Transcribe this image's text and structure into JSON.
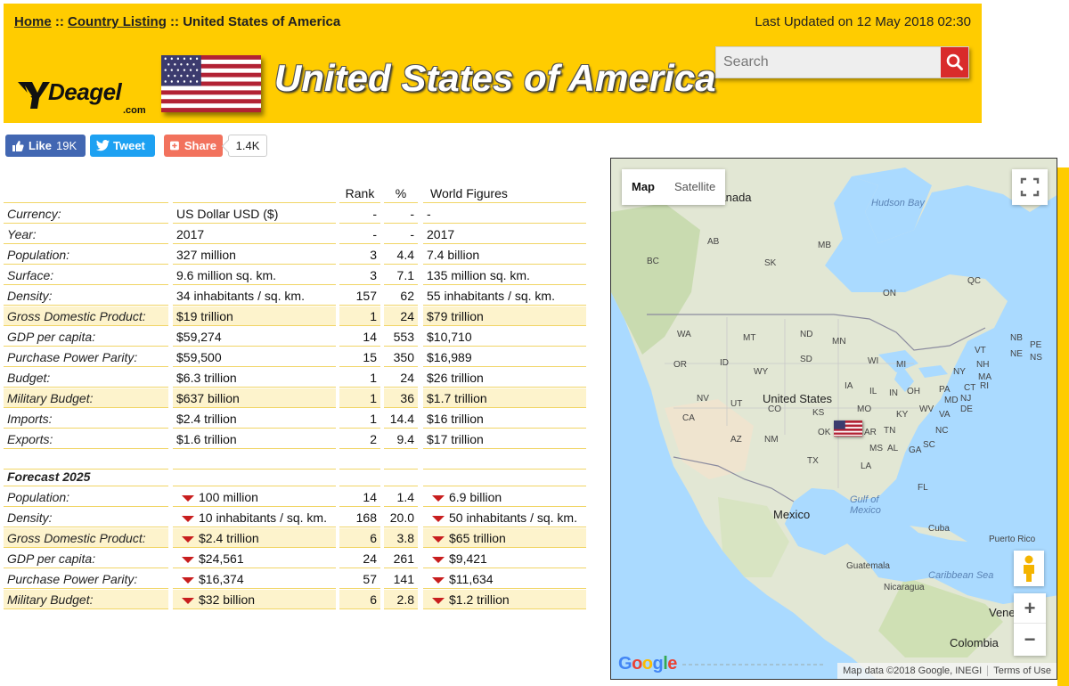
{
  "header": {
    "breadcrumb": {
      "home": "Home",
      "separator": "::",
      "country_listing": "Country Listing",
      "current": "United States of America"
    },
    "last_updated": "Last Updated on 12 May 2018 02:30",
    "logo_text": "Deagel",
    "logo_suffix": ".com",
    "country_title": "United States of America",
    "search_placeholder": "Search",
    "colors": {
      "header_bg": "#ffcc00",
      "search_button": "#d92b2b"
    }
  },
  "social": {
    "like_label": "Like",
    "like_count": "19K",
    "tweet_label": "Tweet",
    "share_label": "Share",
    "share_count": "1.4K"
  },
  "table": {
    "headers": {
      "rank": "Rank",
      "pct": "%",
      "world": "World Figures"
    },
    "rows": [
      {
        "label": "Currency:",
        "value": "US Dollar USD ($)",
        "rank": "-",
        "pct": "-",
        "world": "-",
        "highlight": false
      },
      {
        "label": "Year:",
        "value": "2017",
        "rank": "-",
        "pct": "-",
        "world": "2017",
        "highlight": false
      },
      {
        "label": "Population:",
        "value": "327 million",
        "rank": "3",
        "pct": "4.4",
        "world": "7.4 billion",
        "highlight": false
      },
      {
        "label": "Surface:",
        "value": "9.6 million sq. km.",
        "rank": "3",
        "pct": "7.1",
        "world": "135 million sq. km.",
        "highlight": false
      },
      {
        "label": "Density:",
        "value": "34 inhabitants / sq. km.",
        "rank": "157",
        "pct": "62",
        "world": "55 inhabitants / sq. km.",
        "highlight": false
      },
      {
        "label": "Gross Domestic Product:",
        "value": "$19 trillion",
        "rank": "1",
        "pct": "24",
        "world": "$79 trillion",
        "highlight": true
      },
      {
        "label": "GDP per capita:",
        "value": "$59,274",
        "rank": "14",
        "pct": "553",
        "world": "$10,710",
        "highlight": false
      },
      {
        "label": "Purchase Power Parity:",
        "value": "$59,500",
        "rank": "15",
        "pct": "350",
        "world": "$16,989",
        "highlight": false
      },
      {
        "label": "Budget:",
        "value": "$6.3 trillion",
        "rank": "1",
        "pct": "24",
        "world": "$26 trillion",
        "highlight": false
      },
      {
        "label": "Military Budget:",
        "value": "$637 billion",
        "rank": "1",
        "pct": "36",
        "world": "$1.7 trillion",
        "highlight": true
      },
      {
        "label": "Imports:",
        "value": "$2.4 trillion",
        "rank": "1",
        "pct": "14.4",
        "world": "$16 trillion",
        "highlight": false
      },
      {
        "label": "Exports:",
        "value": "$1.6 trillion",
        "rank": "2",
        "pct": "9.4",
        "world": "$17 trillion",
        "highlight": false
      }
    ],
    "forecast_title": "Forecast 2025",
    "forecast_rows": [
      {
        "label": "Population:",
        "value": "100 million",
        "rank": "14",
        "pct": "1.4",
        "world": "6.9 billion",
        "highlight": false
      },
      {
        "label": "Density:",
        "value": "10 inhabitants / sq. km.",
        "rank": "168",
        "pct": "20.0",
        "world": "50 inhabitants / sq. km.",
        "highlight": false
      },
      {
        "label": "Gross Domestic Product:",
        "value": "$2.4 trillion",
        "rank": "6",
        "pct": "3.8",
        "world": "$65 trillion",
        "highlight": true
      },
      {
        "label": "GDP per capita:",
        "value": "$24,561",
        "rank": "24",
        "pct": "261",
        "world": "$9,421",
        "highlight": false
      },
      {
        "label": "Purchase Power Parity:",
        "value": "$16,374",
        "rank": "57",
        "pct": "141",
        "world": "$11,634",
        "highlight": false
      },
      {
        "label": "Military Budget:",
        "value": "$32 billion",
        "rank": "6",
        "pct": "2.8",
        "world": "$1.2 trillion",
        "highlight": true
      }
    ],
    "colors": {
      "highlight_row": "#fdf3cc",
      "row_border": "#f1d566",
      "down_arrow": "#c81e1e"
    }
  },
  "map": {
    "type_map": "Map",
    "type_satellite": "Satellite",
    "zoom_in": "+",
    "zoom_out": "−",
    "google": "Google",
    "attribution": "Map data ©2018 Google, INEGI",
    "terms": "Terms of Use",
    "labels": {
      "canada": "Canada",
      "hudson_bay": "Hudson Bay",
      "united_states": "United States",
      "mexico": "Mexico",
      "gulf_of_mexico": "Gulf of Mexico",
      "cuba": "Cuba",
      "puerto_rico": "Puerto Rico",
      "guatemala": "Guatemala",
      "caribbean_sea": "Caribbean Sea",
      "nicaragua": "Nicaragua",
      "venezuela": "Vene",
      "colombia": "Colombia",
      "ab": "AB",
      "bc": "BC",
      "sk": "SK",
      "mb": "MB",
      "on": "ON",
      "qc": "QC",
      "nb": "NB",
      "pe": "PE",
      "ns": "NS",
      "ne_st": "NE",
      "wa": "WA",
      "mt": "MT",
      "nd": "ND",
      "mn": "MN",
      "or": "OR",
      "id": "ID",
      "sd": "SD",
      "wi": "WI",
      "mi": "MI",
      "wy": "WY",
      "ny": "NY",
      "vt": "VT",
      "nh": "NH",
      "ma": "MA",
      "nv": "NV",
      "ut": "UT",
      "co": "CO",
      "ks": "KS",
      "ia": "IA",
      "il": "IL",
      "in": "IN",
      "oh": "OH",
      "pa": "PA",
      "nj": "NJ",
      "ct": "CT",
      "ri": "RI",
      "md": "MD",
      "de": "DE",
      "ca": "CA",
      "mo": "MO",
      "ky": "KY",
      "wv": "WV",
      "va": "VA",
      "az": "AZ",
      "nm": "NM",
      "ok": "OK",
      "tn": "TN",
      "nc": "NC",
      "ar": "AR",
      "sc": "SC",
      "ms": "MS",
      "al": "AL",
      "ga": "GA",
      "tx": "TX",
      "la": "LA",
      "fl": "FL"
    }
  }
}
